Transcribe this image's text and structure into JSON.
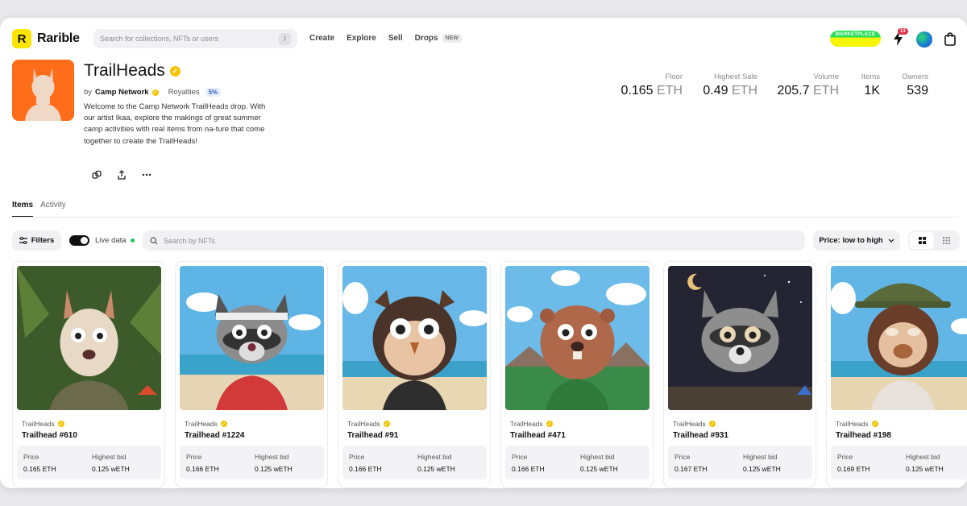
{
  "header": {
    "logo_text": "Rarible",
    "logo_mark": "R",
    "search_placeholder": "Search for collections, NFTs or users",
    "search_shortcut": "/",
    "nav": [
      {
        "label": "Create"
      },
      {
        "label": "Explore"
      },
      {
        "label": "Sell"
      },
      {
        "label": "Drops",
        "badge": "NEW"
      }
    ],
    "marketplace_badge": "MARKETPLACE",
    "notification_count": "13",
    "icons": [
      "lightning-bolt-icon",
      "wallet-avatar",
      "shopping-bag-icon"
    ]
  },
  "collection": {
    "title": "TrailHeads",
    "by_prefix": "by",
    "creator": "Camp Network",
    "royalties_label": "Royalties",
    "royalties_value": "5%",
    "description": "Welcome to the Camp Network TrailHeads drop. With our artist Ikaa, explore the makings of great summer camp activities with real items from na-ture that come together to create the TrailHeads!",
    "action_icons": [
      "copy-link-icon",
      "share-icon",
      "more-icon"
    ],
    "image_bg_color": "#ff6d1a"
  },
  "stats": [
    {
      "label": "Floor",
      "value": "0.165",
      "unit": "ETH"
    },
    {
      "label": "Highest Sale",
      "value": "0.49",
      "unit": "ETH"
    },
    {
      "label": "Volume",
      "value": "205.7",
      "unit": "ETH"
    },
    {
      "label": "Items",
      "value": "1K",
      "unit": ""
    },
    {
      "label": "Owners",
      "value": "539",
      "unit": ""
    }
  ],
  "tabs": [
    {
      "label": "Items",
      "active": true
    },
    {
      "label": "Activity",
      "active": false
    }
  ],
  "toolbar": {
    "filters_label": "Filters",
    "live_data_label": "Live data",
    "live_data_on": true,
    "search_placeholder": "Search by NFTs",
    "sort_label": "Price: low to high",
    "view_mode": "grid"
  },
  "cards": [
    {
      "collection": "TrailHeads",
      "name": "Trailhead #610",
      "price_label": "Price",
      "price": "0.165 ETH",
      "bid_label": "Highest bid",
      "bid": "0.125 wETH"
    },
    {
      "collection": "TrailHeads",
      "name": "Trailhead #1224",
      "price_label": "Price",
      "price": "0.166 ETH",
      "bid_label": "Highest bid",
      "bid": "0.125 wETH"
    },
    {
      "collection": "TrailHeads",
      "name": "Trailhead #91",
      "price_label": "Price",
      "price": "0.166 ETH",
      "bid_label": "Highest bid",
      "bid": "0.125 wETH"
    },
    {
      "collection": "TrailHeads",
      "name": "Trailhead #471",
      "price_label": "Price",
      "price": "0.166 ETH",
      "bid_label": "Highest bid",
      "bid": "0.125 wETH"
    },
    {
      "collection": "TrailHeads",
      "name": "Trailhead #931",
      "price_label": "Price",
      "price": "0.167 ETH",
      "bid_label": "Highest bid",
      "bid": "0.125 wETH"
    },
    {
      "collection": "TrailHeads",
      "name": "Trailhead #198",
      "price_label": "Price",
      "price": "0.169 ETH",
      "bid_label": "Highest bid",
      "bid": "0.125 wETH"
    }
  ],
  "colors": {
    "brand_yellow": "#fee500",
    "live_green": "#21c35a",
    "notif_red": "#e0304a",
    "verified_gold": "#f5c400"
  }
}
